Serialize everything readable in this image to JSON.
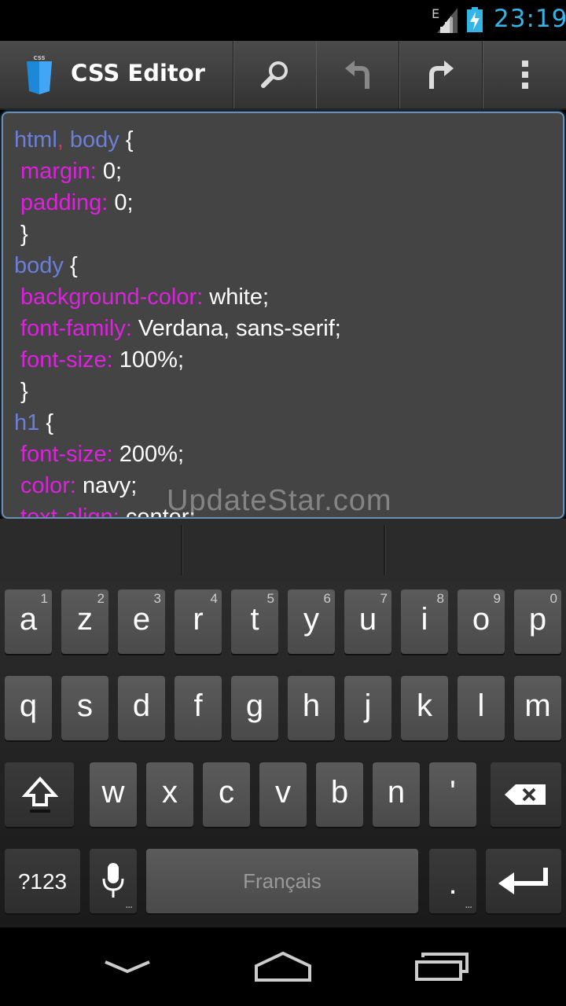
{
  "status": {
    "network": "E",
    "time": "23:19"
  },
  "app": {
    "title": "CSS Editor",
    "logo_text": "CSS"
  },
  "actions": [
    {
      "name": "search-button",
      "icon": "search-icon"
    },
    {
      "name": "undo-button",
      "icon": "undo-icon"
    },
    {
      "name": "redo-button",
      "icon": "redo-icon"
    },
    {
      "name": "overflow-menu-button",
      "icon": "overflow-icon"
    }
  ],
  "code": [
    [
      [
        "sel",
        "html"
      ],
      [
        "comma",
        ","
      ],
      [
        "sel",
        " body"
      ],
      [
        "brace",
        " {"
      ]
    ],
    [
      [
        "prop",
        " margin:"
      ],
      [
        "val",
        " 0;"
      ]
    ],
    [
      [
        "prop",
        " padding:"
      ],
      [
        "val",
        " 0;"
      ]
    ],
    [
      [
        "brace",
        " }"
      ]
    ],
    [
      [
        "sel",
        "body"
      ],
      [
        "brace",
        " {"
      ]
    ],
    [
      [
        "prop",
        " background-color:"
      ],
      [
        "val",
        " white;"
      ]
    ],
    [
      [
        "prop",
        " font-family:"
      ],
      [
        "val",
        " Verdana, sans-serif;"
      ]
    ],
    [
      [
        "prop",
        " font-size:"
      ],
      [
        "val",
        " 100%;"
      ]
    ],
    [
      [
        "brace",
        " }"
      ]
    ],
    [
      [
        "sel",
        "h1"
      ],
      [
        "brace",
        " {"
      ]
    ],
    [
      [
        "prop",
        " font-size:"
      ],
      [
        "val",
        " 200%;"
      ]
    ],
    [
      [
        "prop",
        " color:"
      ],
      [
        "val",
        " navy;"
      ]
    ],
    [
      [
        "prop",
        " text-align:"
      ],
      [
        "val",
        " center;"
      ]
    ]
  ],
  "watermark": "UpdateStar.com",
  "keyboard": {
    "row1": [
      [
        "a",
        "1"
      ],
      [
        "z",
        "2"
      ],
      [
        "e",
        "3"
      ],
      [
        "r",
        "4"
      ],
      [
        "t",
        "5"
      ],
      [
        "y",
        "6"
      ],
      [
        "u",
        "7"
      ],
      [
        "i",
        "8"
      ],
      [
        "o",
        "9"
      ],
      [
        "p",
        "0"
      ]
    ],
    "row2": [
      "q",
      "s",
      "d",
      "f",
      "g",
      "h",
      "j",
      "k",
      "l",
      "m"
    ],
    "row3": [
      "w",
      "x",
      "c",
      "v",
      "b",
      "n",
      "'"
    ],
    "symbols_label": "?123",
    "space_label": "Français",
    "period_label": ".",
    "more_dots": "..."
  },
  "colors": {
    "accent": "#33b5e5",
    "selector": "#6b7fd8",
    "property": "#e020e0"
  }
}
